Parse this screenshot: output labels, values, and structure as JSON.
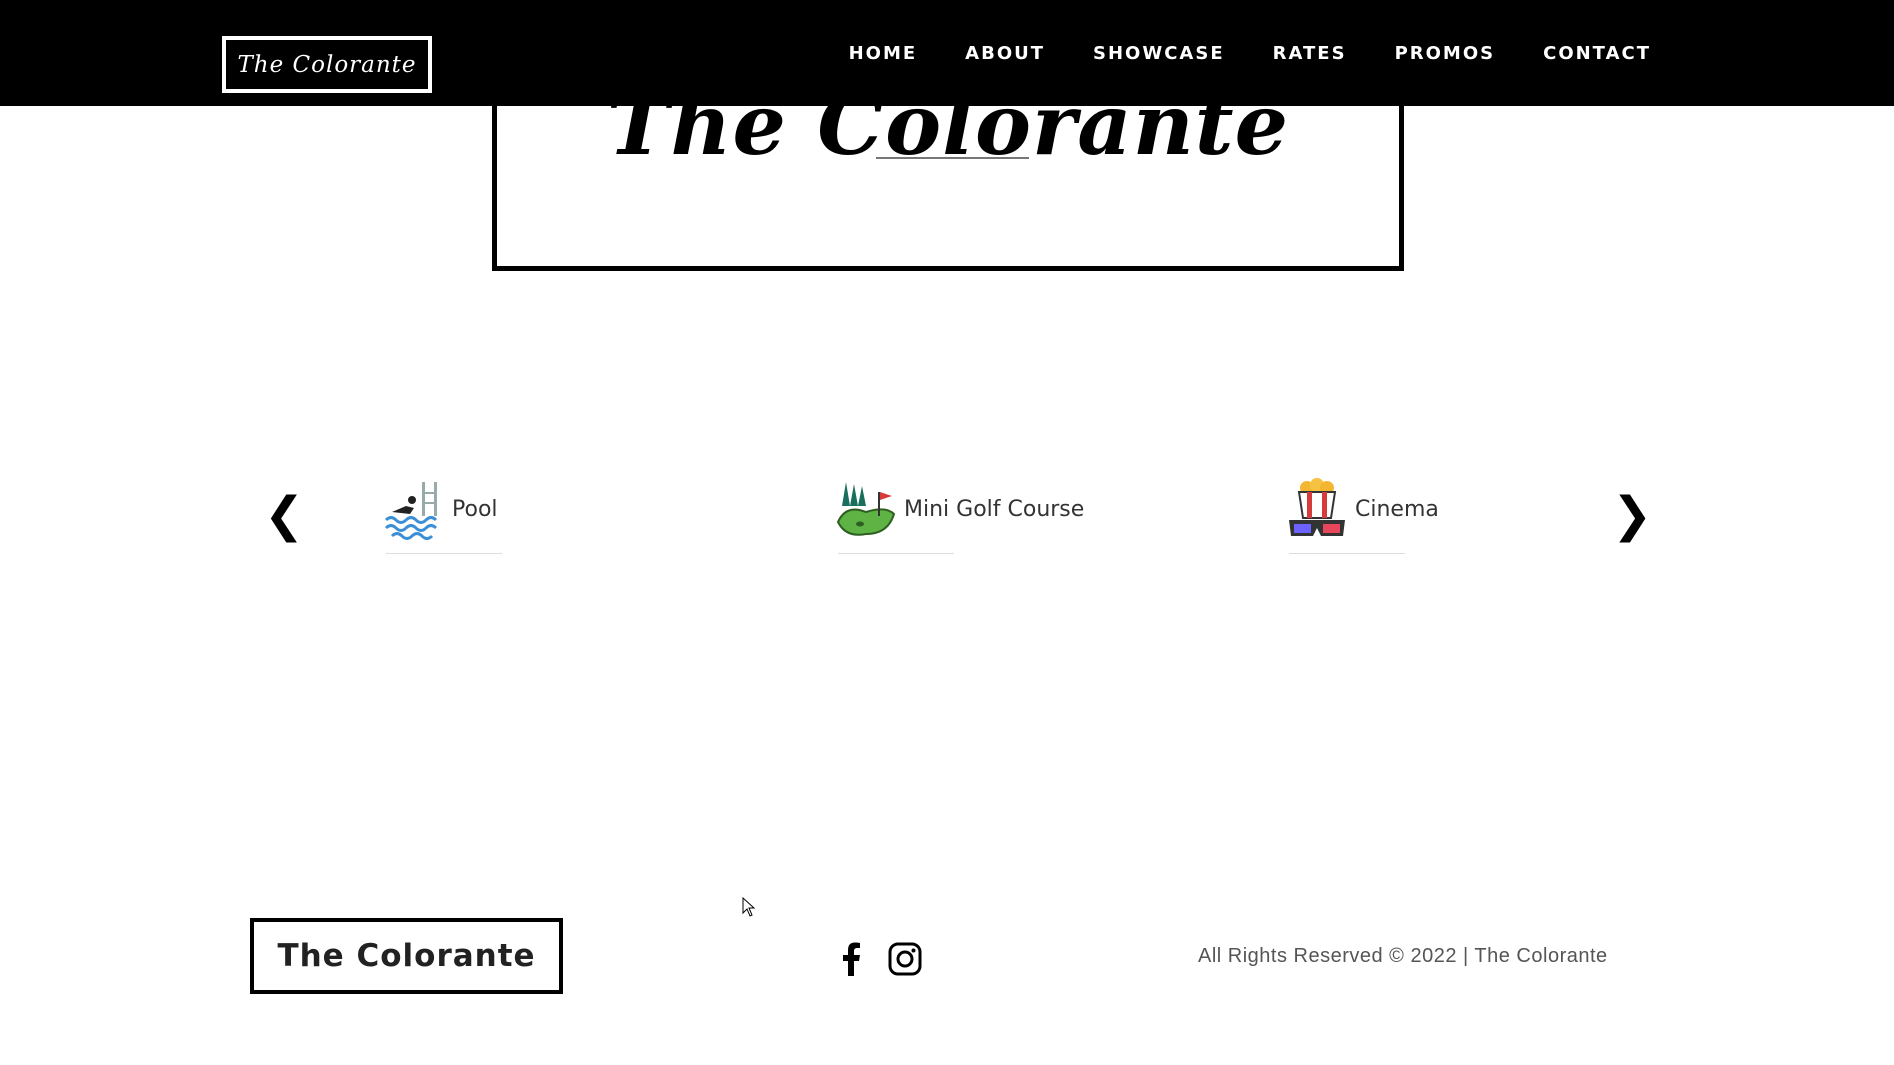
{
  "header": {
    "brand": "The Colorante",
    "nav": [
      "HOME",
      "ABOUT",
      "SHOWCASE",
      "RATES",
      "PROMOS",
      "CONTACT"
    ]
  },
  "hero": {
    "title": "The Colorante"
  },
  "amenities": {
    "prev_icon": "chevron-left-icon",
    "next_icon": "chevron-right-icon",
    "prev_glyph": "❮",
    "next_glyph": "❯",
    "items": [
      {
        "label": "Pool",
        "icon": "pool-icon"
      },
      {
        "label": "Mini Golf Course",
        "icon": "mini-golf-icon"
      },
      {
        "label": "Cinema",
        "icon": "cinema-icon"
      }
    ]
  },
  "footer": {
    "brand": "The Colorante",
    "social": [
      {
        "name": "facebook",
        "icon": "facebook-icon"
      },
      {
        "name": "instagram",
        "icon": "instagram-icon"
      }
    ],
    "copyright": "All Rights Reserved © 2022 | The Colorante"
  },
  "colors": {
    "header_bg": "#000000",
    "page_bg": "#ffffff",
    "text_dark": "#333333",
    "text_muted": "#555555"
  }
}
